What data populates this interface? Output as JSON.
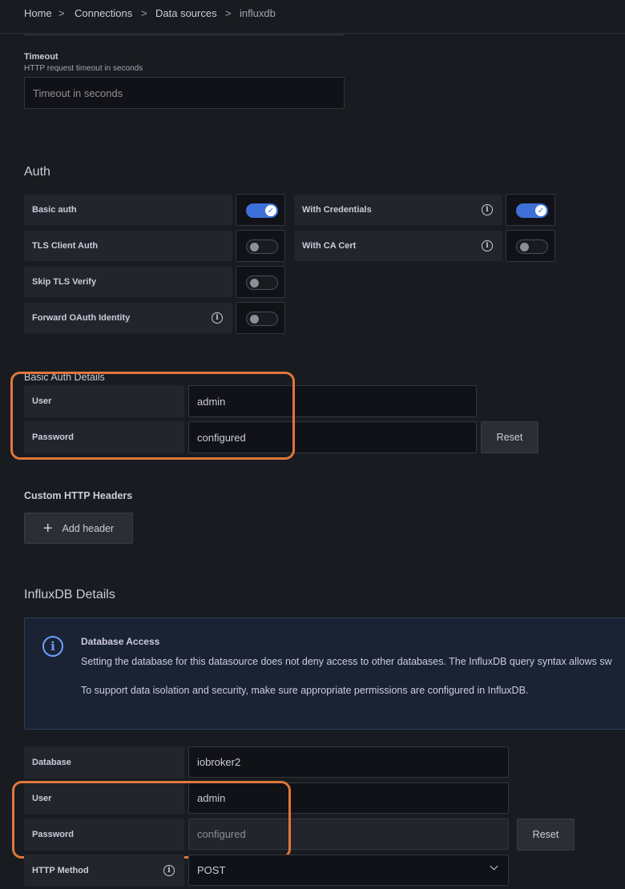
{
  "breadcrumb": {
    "items": [
      "Home",
      "Connections",
      "Data sources",
      "influxdb"
    ],
    "separator": ">"
  },
  "timeout": {
    "label": "Timeout",
    "description": "HTTP request timeout in seconds",
    "placeholder": "Timeout in seconds"
  },
  "auth": {
    "title": "Auth",
    "options": [
      {
        "label": "Basic auth",
        "enabled": true
      },
      {
        "label": "With Credentials",
        "enabled": true
      },
      {
        "label": "TLS Client Auth",
        "enabled": false
      },
      {
        "label": "With CA Cert",
        "enabled": false
      },
      {
        "label": "Skip TLS Verify",
        "enabled": false
      },
      {
        "label": "Forward OAuth Identity",
        "enabled": false
      }
    ]
  },
  "basic_auth_details": {
    "title": "Basic Auth Details",
    "user_label": "User",
    "user_value": "admin",
    "password_label": "Password",
    "password_value": "configured",
    "reset_label": "Reset"
  },
  "custom_headers": {
    "title": "Custom HTTP Headers",
    "add_label": "Add header"
  },
  "influx": {
    "title": "InfluxDB Details",
    "alert": {
      "title": "Database Access",
      "line1": "Setting the database for this datasource does not deny access to other databases. The InfluxDB query syntax allows sw",
      "line2": "To support data isolation and security, make sure appropriate permissions are configured in InfluxDB."
    },
    "database_label": "Database",
    "database_value": "iobroker2",
    "user_label": "User",
    "user_value": "admin",
    "password_label": "Password",
    "password_value": "configured",
    "reset_label": "Reset",
    "method_label": "HTTP Method",
    "method_value": "POST"
  },
  "colors": {
    "accent": "#3d71d9",
    "highlight": "#e0773a",
    "background": "#181b1f",
    "info": "#6e9fff"
  }
}
